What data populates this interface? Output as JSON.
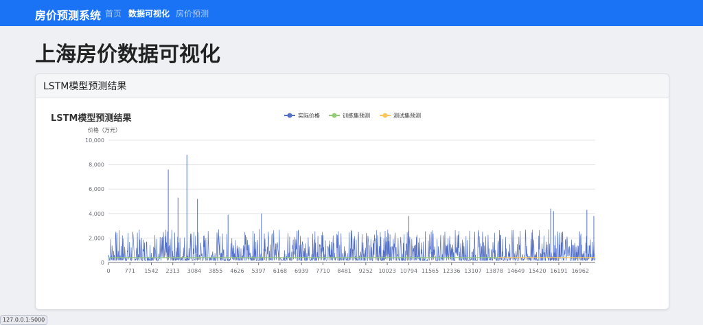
{
  "navbar": {
    "brand": "房价预测系统",
    "links": [
      {
        "label": "首页",
        "active": false
      },
      {
        "label": "数据可视化",
        "active": true
      },
      {
        "label": "房价预测",
        "active": false
      }
    ]
  },
  "page": {
    "title": "上海房价数据可视化"
  },
  "card": {
    "header": "LSTM模型预测结果"
  },
  "status_url": "127.0.0.1:5000",
  "colors": {
    "nav": "#1a73f5",
    "actual": "#5470c6",
    "train": "#91cc75",
    "test": "#fac858"
  },
  "chart_data": {
    "type": "line",
    "title": "LSTM模型预测结果",
    "ylabel": "价格（万元）",
    "xlabel": "",
    "ylim": [
      0,
      10000
    ],
    "yticks": [
      "0",
      "2,000",
      "4,000",
      "6,000",
      "8,000",
      "10,000"
    ],
    "xticks": [
      "0",
      "771",
      "1542",
      "2313",
      "3084",
      "3855",
      "4626",
      "5397",
      "6168",
      "6939",
      "7710",
      "8481",
      "9252",
      "10023",
      "10794",
      "11565",
      "12336",
      "13107",
      "13878",
      "14649",
      "15420",
      "16191",
      "16962"
    ],
    "xlim": [
      0,
      17500
    ],
    "legend_position": "top",
    "grid": true,
    "series": [
      {
        "name": "实际价格",
        "color": "#5470c6",
        "typical_range": [
          0,
          2600
        ],
        "peaks": [
          [
            2150,
            7600
          ],
          [
            2500,
            5300
          ],
          [
            2820,
            8800
          ],
          [
            3200,
            5200
          ],
          [
            4300,
            3900
          ],
          [
            5500,
            4000
          ],
          [
            10800,
            3800
          ],
          [
            15900,
            4400
          ],
          [
            16000,
            4200
          ],
          [
            17200,
            4300
          ],
          [
            17450,
            3800
          ]
        ]
      },
      {
        "name": "训练集预测",
        "color": "#91cc75",
        "approx_value": 400
      },
      {
        "name": "测试集预测",
        "color": "#fac858",
        "approx_value": 400
      }
    ]
  }
}
